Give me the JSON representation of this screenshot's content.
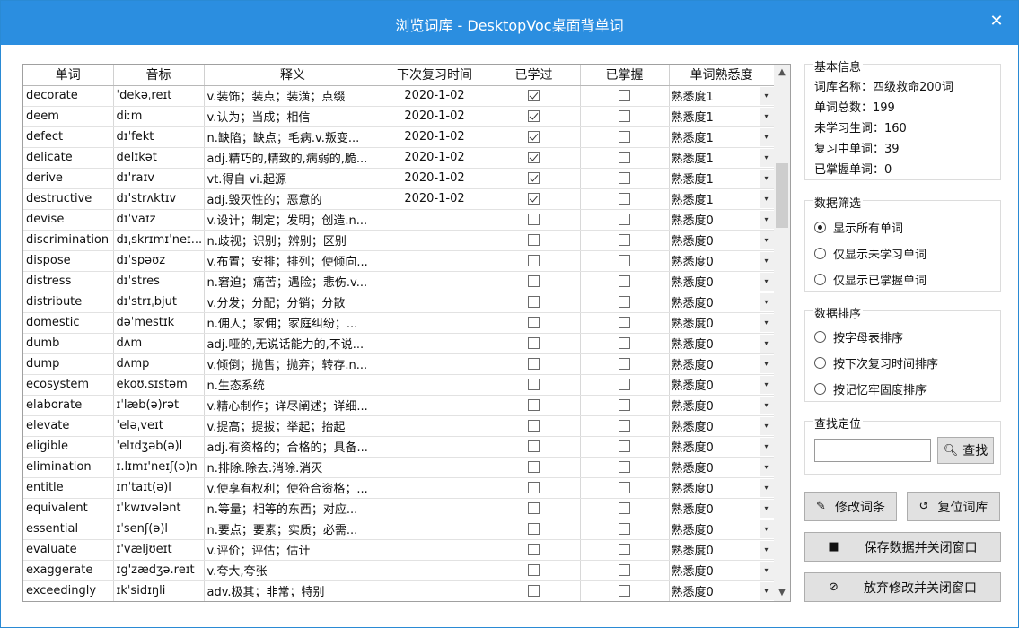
{
  "window": {
    "title": "浏览词库 - DesktopVoc桌面背单词",
    "close_glyph": "✕"
  },
  "table": {
    "columns": [
      "单词",
      "音标",
      "释义",
      "下次复习时间",
      "已学过",
      "已掌握",
      "单词熟悉度"
    ],
    "rows": [
      {
        "word": "decorate",
        "ipa": "ˈdekəˌreɪt",
        "meaning": "v.装饰；装点；装潢；点缀",
        "date": "2020-1-02",
        "learned": true,
        "mastered": false,
        "level": "熟悉度1"
      },
      {
        "word": "deem",
        "ipa": "diːm",
        "meaning": "v.认为；当成；相信",
        "date": "2020-1-02",
        "learned": true,
        "mastered": false,
        "level": "熟悉度1"
      },
      {
        "word": "defect",
        "ipa": "dɪˈfekt",
        "meaning": "n.缺陷；缺点；毛病.v.叛变...",
        "date": "2020-1-02",
        "learned": true,
        "mastered": false,
        "level": "熟悉度1"
      },
      {
        "word": "delicate",
        "ipa": "delɪkət",
        "meaning": "adj.精巧的,精致的,病弱的,脆...",
        "date": "2020-1-02",
        "learned": true,
        "mastered": false,
        "level": "熟悉度1"
      },
      {
        "word": "derive",
        "ipa": "dɪ'raɪv",
        "meaning": "vt.得自 vi.起源",
        "date": "2020-1-02",
        "learned": true,
        "mastered": false,
        "level": "熟悉度1"
      },
      {
        "word": "destructive",
        "ipa": "dɪ'strʌktɪv",
        "meaning": "adj.毁灭性的；恶意的",
        "date": "2020-1-02",
        "learned": true,
        "mastered": false,
        "level": "熟悉度1"
      },
      {
        "word": "devise",
        "ipa": "dɪˈvaɪz",
        "meaning": "v.设计；制定；发明；创造.n...",
        "date": "",
        "learned": false,
        "mastered": false,
        "level": "熟悉度0"
      },
      {
        "word": "discrimination",
        "ipa": "dɪˌskrɪmɪˈneɪ...",
        "meaning": "n.歧视；识别；辨别；区别",
        "date": "",
        "learned": false,
        "mastered": false,
        "level": "熟悉度0"
      },
      {
        "word": "dispose",
        "ipa": "dɪˈspəʊz",
        "meaning": "v.布置；安排；排列；使倾向...",
        "date": "",
        "learned": false,
        "mastered": false,
        "level": "熟悉度0"
      },
      {
        "word": "distress",
        "ipa": "dɪˈstres",
        "meaning": "n.窘迫；痛苦；遇险；悲伤.v...",
        "date": "",
        "learned": false,
        "mastered": false,
        "level": "熟悉度0"
      },
      {
        "word": "distribute",
        "ipa": "dɪˈstrɪˌbjut",
        "meaning": "v.分发；分配；分销；分散",
        "date": "",
        "learned": false,
        "mastered": false,
        "level": "熟悉度0"
      },
      {
        "word": "domestic",
        "ipa": "dəˈmestɪk",
        "meaning": "n.佣人；家佣；家庭纠纷；...",
        "date": "",
        "learned": false,
        "mastered": false,
        "level": "熟悉度0"
      },
      {
        "word": "dumb",
        "ipa": "dʌm",
        "meaning": "adj.哑的,无说话能力的,不说...",
        "date": "",
        "learned": false,
        "mastered": false,
        "level": "熟悉度0"
      },
      {
        "word": "dump",
        "ipa": "dʌmp",
        "meaning": "v.倾倒；抛售；抛弃；转存.n...",
        "date": "",
        "learned": false,
        "mastered": false,
        "level": "熟悉度0"
      },
      {
        "word": "ecosystem",
        "ipa": "ekoʊ.sɪstəm",
        "meaning": "n.生态系统",
        "date": "",
        "learned": false,
        "mastered": false,
        "level": "熟悉度0"
      },
      {
        "word": "elaborate",
        "ipa": "ɪˈlæb(ə)rət",
        "meaning": "v.精心制作；详尽阐述；详细...",
        "date": "",
        "learned": false,
        "mastered": false,
        "level": "熟悉度0"
      },
      {
        "word": "elevate",
        "ipa": "ˈeləˌveɪt",
        "meaning": "v.提高；提拔；举起；抬起",
        "date": "",
        "learned": false,
        "mastered": false,
        "level": "熟悉度0"
      },
      {
        "word": "eligible",
        "ipa": "ˈelɪdʒəb(ə)l",
        "meaning": "adj.有资格的；合格的；具备...",
        "date": "",
        "learned": false,
        "mastered": false,
        "level": "熟悉度0"
      },
      {
        "word": "elimination",
        "ipa": "ɪ.lɪmɪ'neɪʃ(ə)n",
        "meaning": "n.排除.除去.消除.消灭",
        "date": "",
        "learned": false,
        "mastered": false,
        "level": "熟悉度0"
      },
      {
        "word": "entitle",
        "ipa": "ɪnˈtaɪt(ə)l",
        "meaning": "v.使享有权利；使符合资格；...",
        "date": "",
        "learned": false,
        "mastered": false,
        "level": "熟悉度0"
      },
      {
        "word": "equivalent",
        "ipa": "ɪˈkwɪvələnt",
        "meaning": "n.等量；相等的东西；对应...",
        "date": "",
        "learned": false,
        "mastered": false,
        "level": "熟悉度0"
      },
      {
        "word": "essential",
        "ipa": "ɪˈsenʃ(ə)l",
        "meaning": "n.要点；要素；实质；必需...",
        "date": "",
        "learned": false,
        "mastered": false,
        "level": "熟悉度0"
      },
      {
        "word": "evaluate",
        "ipa": "ɪ'væljʊeɪt",
        "meaning": "v.评价；评估；估计",
        "date": "",
        "learned": false,
        "mastered": false,
        "level": "熟悉度0"
      },
      {
        "word": "exaggerate",
        "ipa": "ɪg'zædʒə.reɪt",
        "meaning": "v.夸大,夸张",
        "date": "",
        "learned": false,
        "mastered": false,
        "level": "熟悉度0"
      },
      {
        "word": "exceedingly",
        "ipa": "ɪkˈsidɪŋli",
        "meaning": "adv.极其；非常；特别",
        "date": "",
        "learned": false,
        "mastered": false,
        "level": "熟悉度0"
      }
    ]
  },
  "info": {
    "legend": "基本信息",
    "name_label": "词库名称：四级救命200词",
    "total_label": "单词总数：199",
    "unlearned_label": "未学习生词：160",
    "reviewing_label": "复习中单词：39",
    "mastered_label": "已掌握单词：0"
  },
  "filter": {
    "legend": "数据筛选",
    "options": [
      "显示所有单词",
      "仅显示未学习单词",
      "仅显示已掌握单词"
    ],
    "selected": 0
  },
  "sort": {
    "legend": "数据排序",
    "options": [
      "按字母表排序",
      "按下次复习时间排序",
      "按记忆牢固度排序"
    ]
  },
  "search": {
    "legend": "查找定位",
    "value": "",
    "button_label": "查找"
  },
  "buttons": {
    "edit": "修改词条",
    "reset": "复位词库",
    "save": "保存数据并关闭窗口",
    "discard": "放弃修改并关闭窗口"
  }
}
